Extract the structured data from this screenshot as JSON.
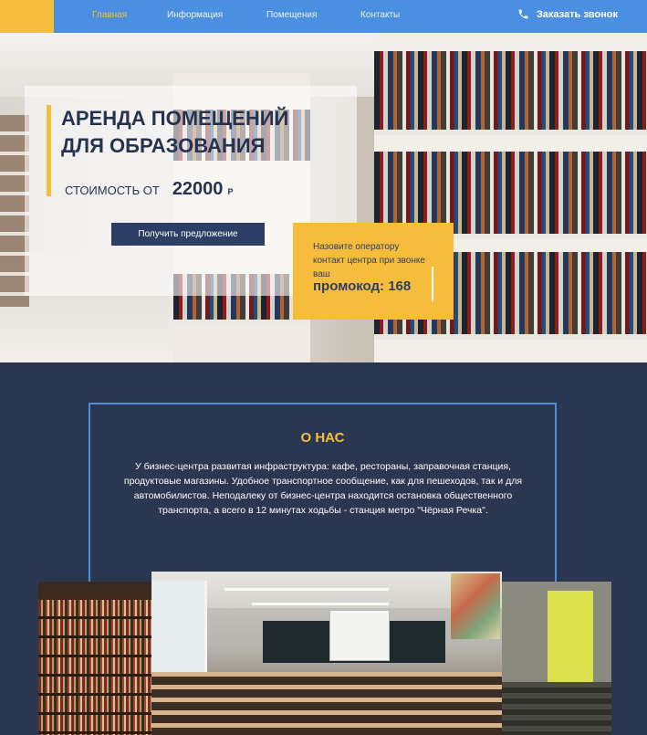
{
  "nav": {
    "items": [
      {
        "label": "Главная",
        "active": true
      },
      {
        "label": "Информация",
        "active": false
      },
      {
        "label": "Помещения",
        "active": false
      },
      {
        "label": "Контакты",
        "active": false
      }
    ],
    "callback_label": "Заказать звонок",
    "callback_icon": "phone-icon"
  },
  "hero": {
    "title": "АРЕНДА ПОМЕЩЕНИЙ ДЛЯ ОБРАЗОВАНИЯ",
    "price_label": "СТОИМОСТЬ ОТ",
    "price_value": "22000",
    "price_currency": "Р",
    "cta_label": "Получить предложение",
    "promo_text": "Назовите оператору контакт центра при звонке ваш",
    "promo_code": "промокод: 168"
  },
  "about": {
    "title": "О НАС",
    "text": "У бизнес-центра развитая инфраструктура: кафе, рестораны, заправочная станция, продуктовые магазины. Удобное транспортное сообщение, как для пешеходов, так и для автомобилистов. Неподалеку от бизнес-центра находится остановка общественного транспорта, а всего в 12 минутах ходьбы - станция метро \"Чёрная Речка\"."
  },
  "colors": {
    "accent_yellow": "#f6bd3d",
    "nav_blue": "#4a8fe0",
    "dark_navy": "#2b3750",
    "button_navy": "#2c3e63"
  }
}
